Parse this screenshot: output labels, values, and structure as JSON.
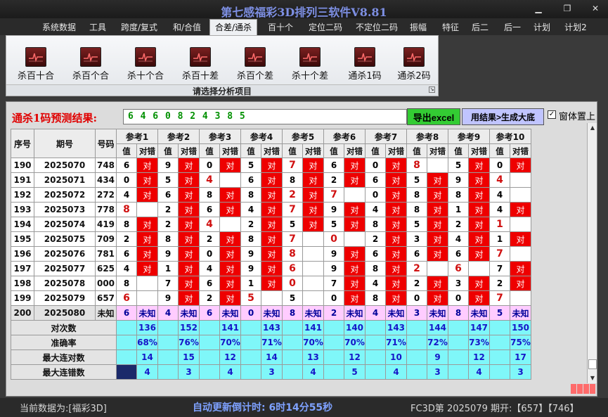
{
  "window": {
    "title": "第七感福彩3D排列三软件V8.81"
  },
  "menu": [
    "系统数据",
    "工具",
    "跨度/复式",
    "和/合值",
    "合差/通杀",
    "百十个",
    "定位二码",
    "不定位二码",
    "振幅",
    "特征",
    "后二",
    "后一",
    "计划",
    "计划2"
  ],
  "menu_active": "合差/通杀",
  "ribbon": {
    "buttons": [
      "杀百十合",
      "杀百个合",
      "杀十个合",
      "杀百十差",
      "杀百个差",
      "杀十个差",
      "通杀1码",
      "通杀2码"
    ],
    "caption": "请选择分析项目"
  },
  "prediction": {
    "label": "通杀1码预测结果:",
    "value": "6 4 6 0 8 2 4 3 8 5",
    "export_button": "导出excel",
    "generate_button": "用结果>生成大底",
    "checkbox_label": "窗体置上",
    "checkbox_checked": true
  },
  "table": {
    "headers": {
      "seq": "序号",
      "period": "期号",
      "number": "号码"
    },
    "refs": [
      "参考1",
      "参考2",
      "参考3",
      "参考4",
      "参考5",
      "参考6",
      "参考7",
      "参考8",
      "参考9",
      "参考10"
    ],
    "sub": {
      "value": "值",
      "check": "对错"
    },
    "hit_text": "对",
    "unknown_text": "未知",
    "rows": [
      {
        "seq": "190",
        "period": "2025070",
        "number": "748",
        "vals": [
          "6",
          "9",
          "0",
          "5",
          "7",
          "6",
          "0",
          "8",
          "5",
          "0"
        ],
        "hits": [
          1,
          1,
          1,
          1,
          1,
          1,
          1,
          0,
          1,
          1
        ],
        "red": [
          0,
          0,
          0,
          0,
          1,
          0,
          0,
          1,
          0,
          0
        ]
      },
      {
        "seq": "191",
        "period": "2025071",
        "number": "434",
        "vals": [
          "0",
          "5",
          "4",
          "6",
          "8",
          "2",
          "6",
          "5",
          "9",
          "4"
        ],
        "hits": [
          1,
          1,
          0,
          1,
          1,
          1,
          1,
          1,
          1,
          0
        ],
        "red": [
          0,
          0,
          1,
          0,
          0,
          0,
          0,
          0,
          0,
          1
        ]
      },
      {
        "seq": "192",
        "period": "2025072",
        "number": "272",
        "vals": [
          "4",
          "6",
          "8",
          "8",
          "2",
          "7",
          "0",
          "8",
          "8",
          "4"
        ],
        "hits": [
          1,
          1,
          1,
          1,
          1,
          0,
          1,
          1,
          1,
          0
        ],
        "red": [
          0,
          0,
          0,
          0,
          1,
          1,
          0,
          0,
          0,
          0
        ]
      },
      {
        "seq": "193",
        "period": "2025073",
        "number": "778",
        "vals": [
          "8",
          "2",
          "6",
          "4",
          "7",
          "9",
          "4",
          "8",
          "1",
          "4"
        ],
        "hits": [
          0,
          1,
          1,
          1,
          1,
          1,
          1,
          1,
          1,
          1
        ],
        "red": [
          1,
          0,
          0,
          0,
          1,
          0,
          0,
          0,
          0,
          0
        ]
      },
      {
        "seq": "194",
        "period": "2025074",
        "number": "419",
        "vals": [
          "8",
          "2",
          "4",
          "2",
          "5",
          "5",
          "8",
          "5",
          "2",
          "1"
        ],
        "hits": [
          1,
          1,
          0,
          1,
          1,
          1,
          1,
          1,
          1,
          0
        ],
        "red": [
          0,
          0,
          1,
          0,
          0,
          0,
          0,
          0,
          0,
          1
        ]
      },
      {
        "seq": "195",
        "period": "2025075",
        "number": "709",
        "vals": [
          "2",
          "8",
          "2",
          "8",
          "7",
          "0",
          "2",
          "3",
          "4",
          "1"
        ],
        "hits": [
          1,
          1,
          1,
          1,
          0,
          0,
          1,
          1,
          1,
          1
        ],
        "red": [
          0,
          0,
          0,
          0,
          1,
          1,
          0,
          0,
          0,
          0
        ]
      },
      {
        "seq": "196",
        "period": "2025076",
        "number": "781",
        "vals": [
          "6",
          "9",
          "0",
          "9",
          "8",
          "9",
          "6",
          "6",
          "6",
          "7"
        ],
        "hits": [
          1,
          1,
          1,
          1,
          0,
          1,
          1,
          1,
          1,
          0
        ],
        "red": [
          0,
          0,
          0,
          0,
          1,
          0,
          0,
          0,
          0,
          1
        ]
      },
      {
        "seq": "197",
        "period": "2025077",
        "number": "625",
        "vals": [
          "4",
          "1",
          "4",
          "9",
          "6",
          "9",
          "8",
          "2",
          "6",
          "7"
        ],
        "hits": [
          1,
          1,
          1,
          1,
          0,
          1,
          1,
          0,
          0,
          1
        ],
        "red": [
          0,
          0,
          0,
          0,
          1,
          0,
          0,
          1,
          1,
          0
        ]
      },
      {
        "seq": "198",
        "period": "2025078",
        "number": "000",
        "vals": [
          "8",
          "7",
          "6",
          "1",
          "0",
          "7",
          "4",
          "2",
          "3",
          "2"
        ],
        "hits": [
          0,
          1,
          1,
          1,
          0,
          1,
          1,
          1,
          1,
          1
        ],
        "red": [
          0,
          0,
          0,
          0,
          1,
          0,
          0,
          0,
          0,
          0
        ]
      },
      {
        "seq": "199",
        "period": "2025079",
        "number": "657",
        "vals": [
          "6",
          "9",
          "2",
          "5",
          "5",
          "0",
          "8",
          "0",
          "0",
          "7"
        ],
        "hits": [
          0,
          1,
          1,
          0,
          0,
          1,
          1,
          1,
          1,
          0
        ],
        "red": [
          1,
          0,
          0,
          1,
          0,
          0,
          0,
          0,
          0,
          1
        ]
      },
      {
        "seq": "200",
        "period": "2025080",
        "number": "未知",
        "vals": [
          "6",
          "4",
          "6",
          "0",
          "8",
          "2",
          "4",
          "3",
          "8",
          "5"
        ],
        "hits": [
          2,
          2,
          2,
          2,
          2,
          2,
          2,
          2,
          2,
          2
        ],
        "red": [
          0,
          0,
          0,
          0,
          0,
          0,
          0,
          0,
          0,
          0
        ]
      }
    ],
    "summary": [
      {
        "label": "对次数",
        "values": [
          "136",
          "152",
          "141",
          "143",
          "141",
          "140",
          "143",
          "144",
          "147",
          "150"
        ]
      },
      {
        "label": "准确率",
        "values": [
          "68%",
          "76%",
          "70%",
          "71%",
          "70%",
          "70%",
          "71%",
          "72%",
          "73%",
          "75%"
        ]
      },
      {
        "label": "最大连对数",
        "values": [
          "14",
          "15",
          "12",
          "14",
          "13",
          "12",
          "10",
          "9",
          "12",
          "17"
        ]
      },
      {
        "label": "最大连错数",
        "values": [
          "4",
          "3",
          "4",
          "3",
          "4",
          "5",
          "4",
          "3",
          "4",
          "3"
        ]
      }
    ]
  },
  "status": {
    "left": "当前数据为:[福彩3D]",
    "countdown": "自动更新倒计时: 6时14分55秒",
    "right": "FC3D第 2025079 期开:【657】【746】"
  },
  "colors": {
    "hit": "#ee0000",
    "summary_bg": "#7ff7f9",
    "pending_bg": "#ffccff",
    "prediction_text": "#009000"
  }
}
